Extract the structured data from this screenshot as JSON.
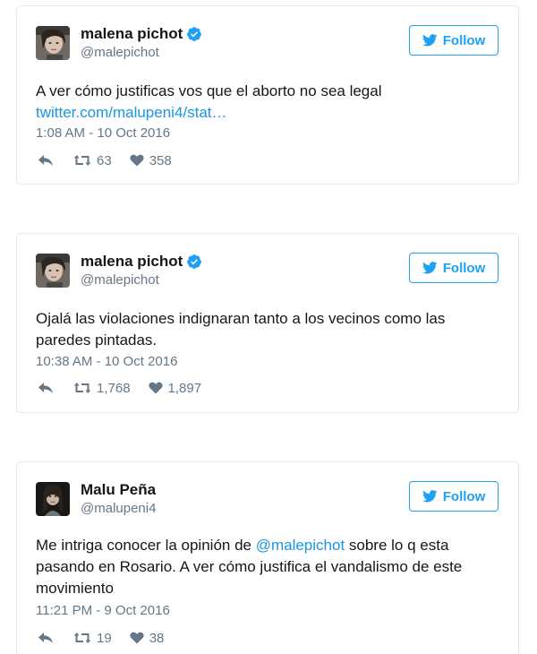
{
  "tweets": [
    {
      "author": {
        "name": "malena pichot",
        "handle": "@malepichot",
        "verified": true,
        "avatar": "avatar-malena"
      },
      "follow_label": "Follow",
      "text_before": "A ver cómo justificas vos que el aborto no sea legal ",
      "link": "twitter.com/malupeni4/stat…",
      "timestamp": "1:08 AM - 10 Oct 2016",
      "retweets": "63",
      "likes": "358"
    },
    {
      "author": {
        "name": "malena pichot",
        "handle": "@malepichot",
        "verified": true,
        "avatar": "avatar-malena"
      },
      "follow_label": "Follow",
      "text": "Ojalá las violaciones indignaran tanto a los vecinos como las paredes pintadas.",
      "timestamp": "10:38 AM - 10 Oct 2016",
      "retweets": "1,768",
      "likes": "1,897"
    },
    {
      "author": {
        "name": "Malu Peña",
        "handle": "@malupeni4",
        "verified": false,
        "avatar": "avatar-malu"
      },
      "follow_label": "Follow",
      "text_before": "Me intriga conocer la opinión de ",
      "mention": "@malepichot",
      "text_after": " sobre lo q esta pasando en Rosario. A ver cómo justifica el vandalismo de este movimiento",
      "timestamp": "11:21 PM - 9 Oct 2016",
      "retweets": "19",
      "likes": "38"
    }
  ],
  "icons": {
    "follow": "twitter-bird-icon",
    "verified": "verified-badge-icon",
    "reply": "reply-icon",
    "retweet": "retweet-icon",
    "like": "heart-icon"
  },
  "colors": {
    "accent": "#1da1f2",
    "link": "#1b95e0",
    "secondary": "#657786",
    "border": "#e1e8ed"
  }
}
